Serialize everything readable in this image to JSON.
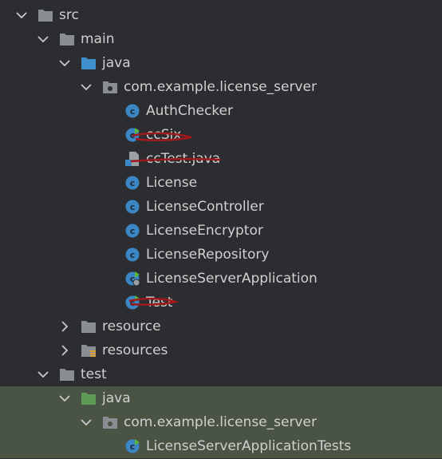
{
  "tree": {
    "src": "src",
    "main": "main",
    "main_java": "java",
    "main_package": "com.example.license_server",
    "classes": [
      "AuthChecker",
      "ccSix",
      "ccTest.java",
      "License",
      "LicenseController",
      "LicenseEncryptor",
      "LicenseRepository",
      "LicenseServerApplication",
      "Test"
    ],
    "resource": "resource",
    "resources": "resources",
    "test": "test",
    "test_java": "java",
    "test_package": "com.example.license_server",
    "test_class": "LicenseServerApplicationTests"
  },
  "colors": {
    "background": "#2b2d30",
    "test_selection": "#4a5444",
    "folder": "#8a8d91",
    "source_folder": "#3f8fcc",
    "test_source_folder": "#5f9b56",
    "class_badge": "#3b86c4",
    "run_marker": "#57b53a",
    "strike_mark": "#a0191b"
  },
  "icons": {
    "folder": "folder-icon",
    "source_root": "source-folder-icon",
    "test_root": "test-source-folder-icon",
    "package": "package-icon",
    "class": "class-icon",
    "runnable_class": "runnable-class-icon",
    "java_file": "java-file-icon",
    "spring_app": "spring-app-class-icon",
    "resources": "resources-folder-icon"
  }
}
